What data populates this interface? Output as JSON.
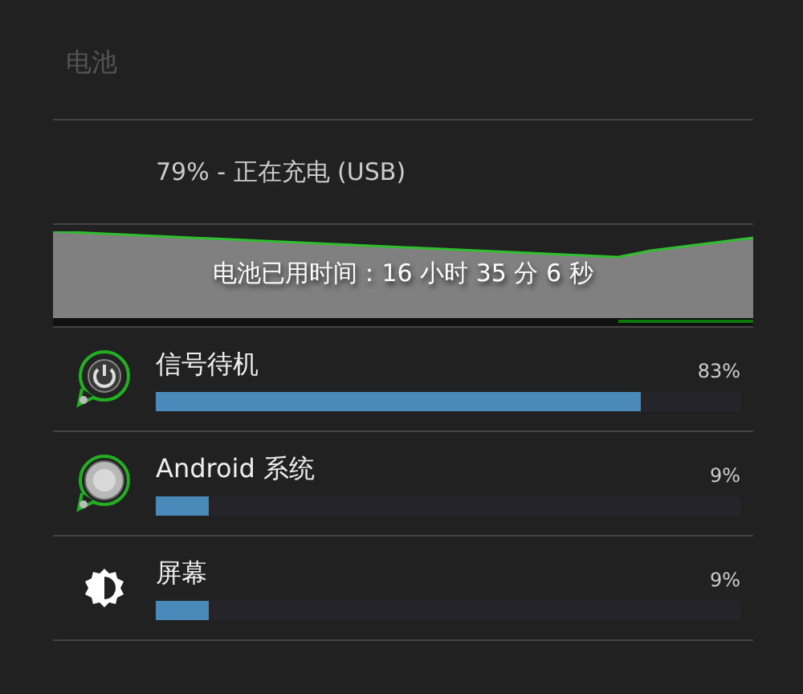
{
  "title": "电池",
  "status": "79% - 正在充电 (USB)",
  "history": {
    "caption": "电池已用时间：16 小时 35 分 6 秒"
  },
  "usage": [
    {
      "kind": "power",
      "name": "信号待机",
      "percent": "83%",
      "level": 0.83
    },
    {
      "kind": "system",
      "name": "Android 系统",
      "percent": "9%",
      "level": 0.09
    },
    {
      "kind": "screen",
      "name": "屏幕",
      "percent": "9%",
      "level": 0.09
    }
  ]
}
